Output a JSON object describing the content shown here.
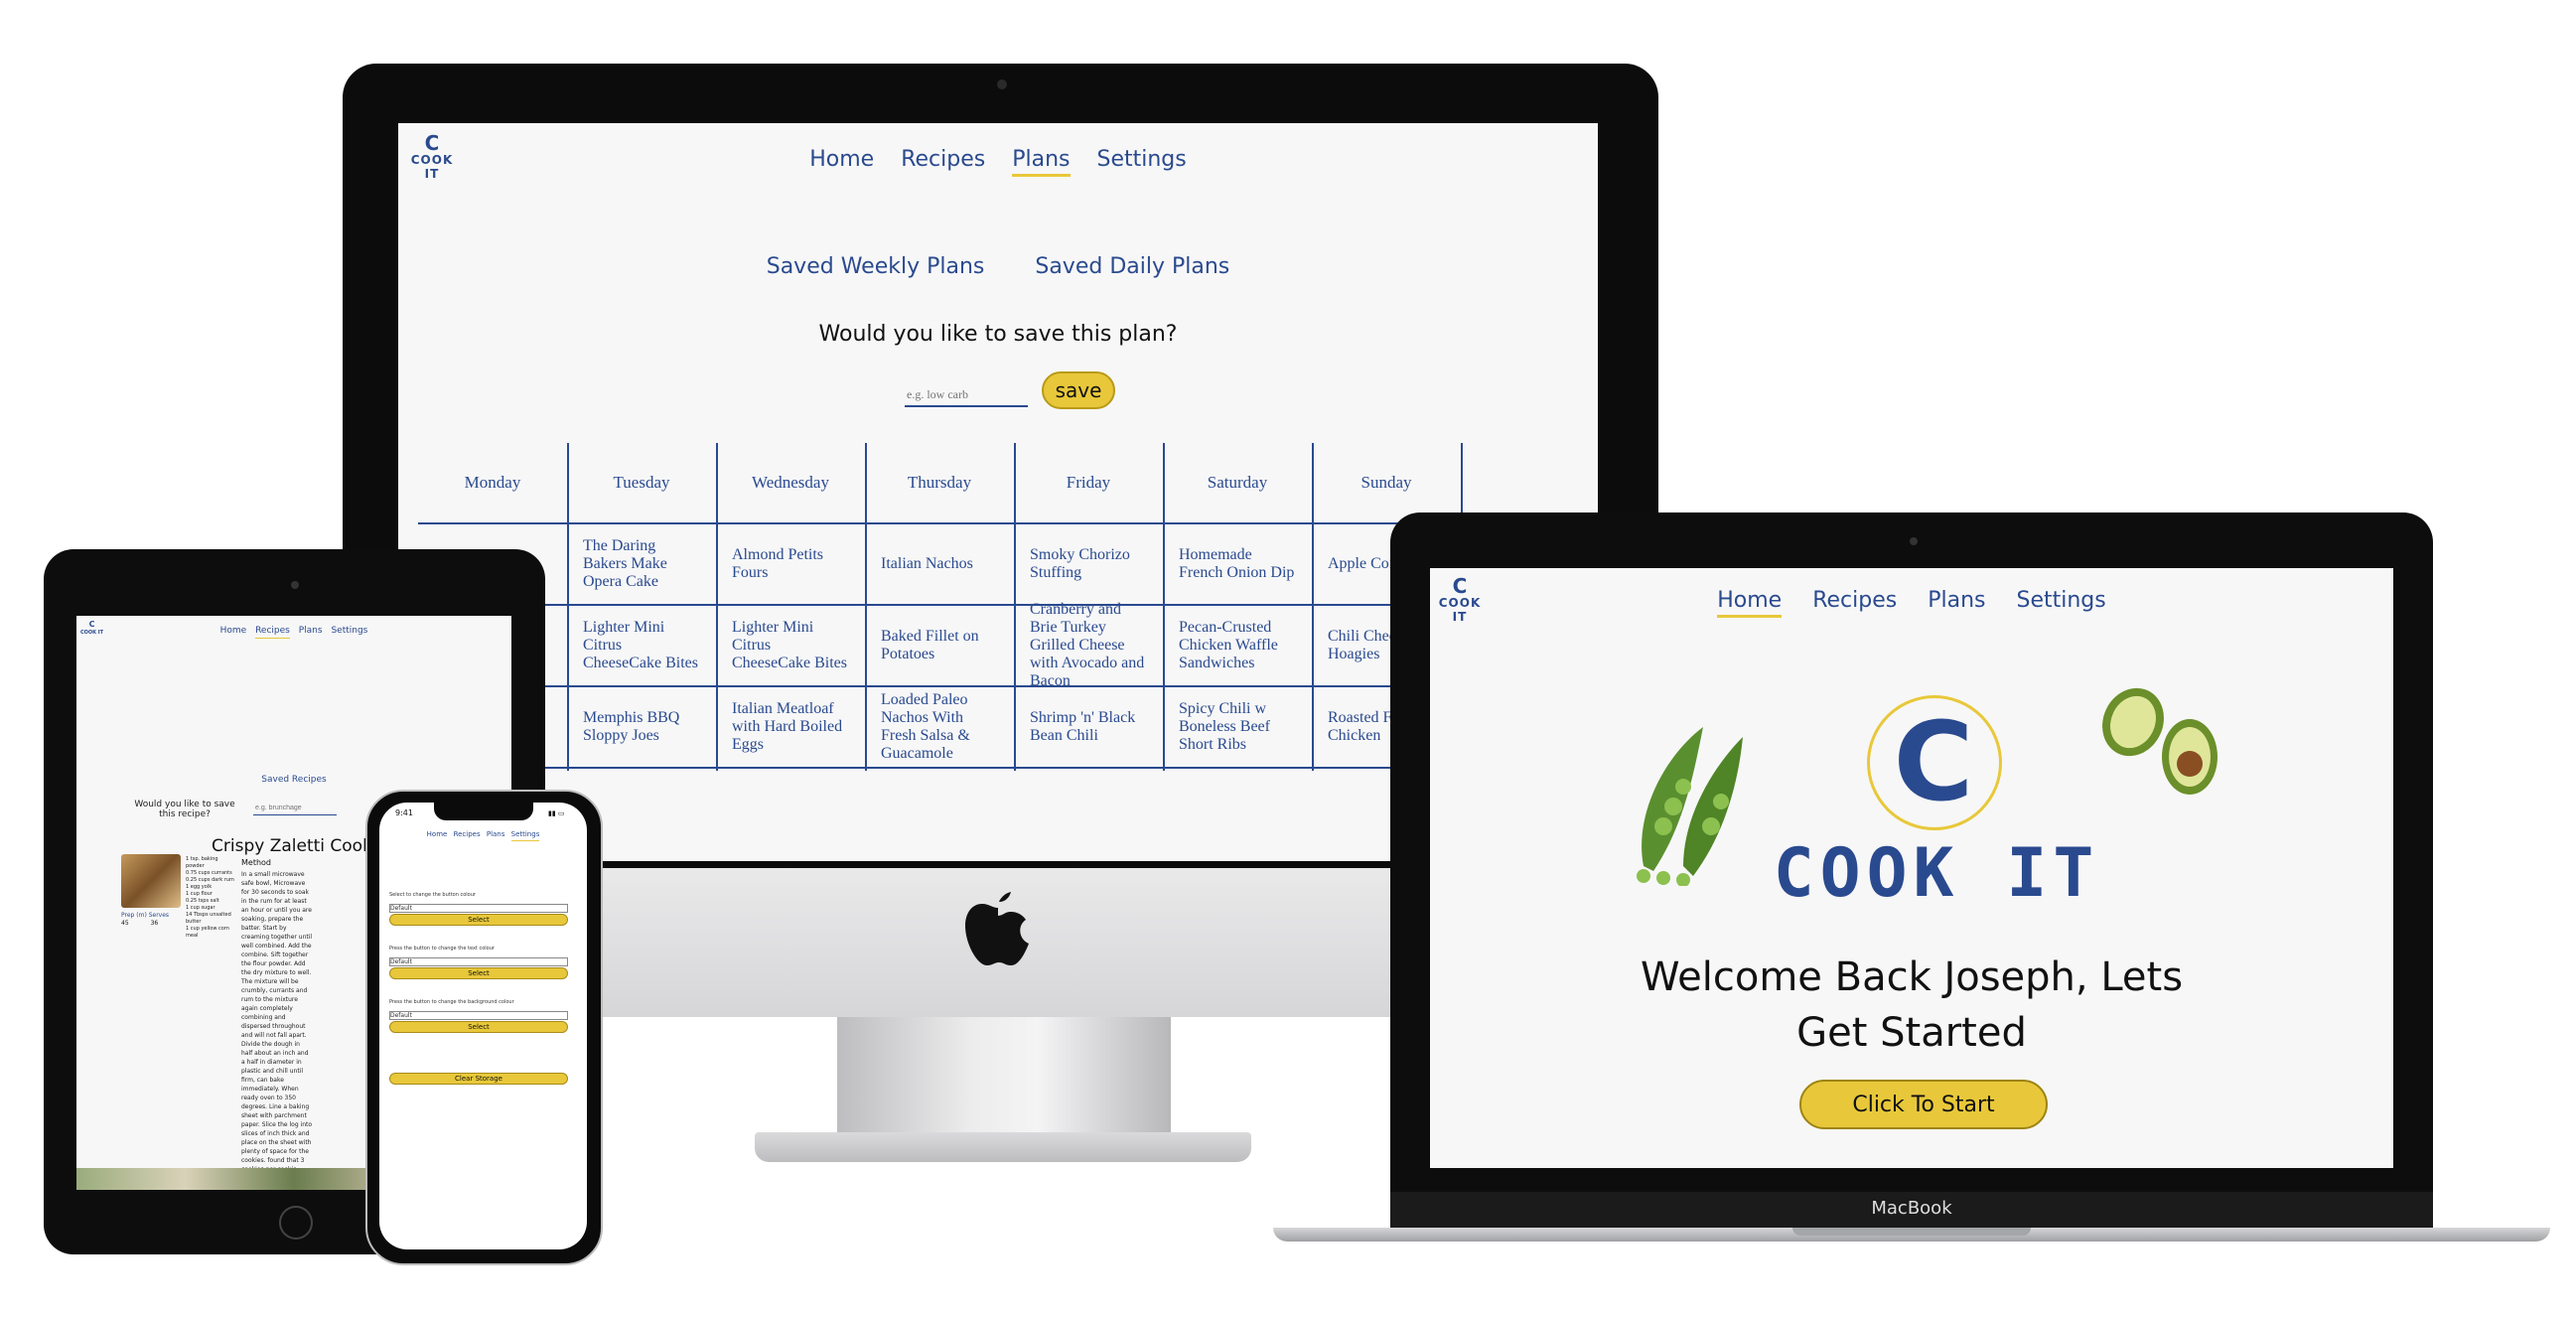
{
  "brand": {
    "logo_letter": "C",
    "logo_text": "COOK IT"
  },
  "nav": {
    "home": "Home",
    "recipes": "Recipes",
    "plans": "Plans",
    "settings": "Settings"
  },
  "imac": {
    "saved_weekly": "Saved Weekly Plans",
    "saved_daily": "Saved Daily Plans",
    "question": "Would you like to save this plan?",
    "input_placeholder": "e.g. low carb",
    "save_label": "save",
    "days": [
      {
        "name": "Monday",
        "meals": [
          "",
          "",
          ""
        ]
      },
      {
        "name": "Tuesday",
        "meals": [
          "The Daring Bakers Make Opera Cake",
          "Lighter Mini Citrus CheeseCake Bites",
          "Memphis BBQ Sloppy Joes"
        ]
      },
      {
        "name": "Wednesday",
        "meals": [
          "Almond Petits Fours",
          "Lighter Mini Citrus CheeseCake Bites",
          "Italian Meatloaf with Hard Boiled Eggs"
        ]
      },
      {
        "name": "Thursday",
        "meals": [
          "Italian Nachos",
          "Baked Fillet on Potatoes",
          "Loaded Paleo Nachos With Fresh Salsa & Guacamole"
        ]
      },
      {
        "name": "Friday",
        "meals": [
          "Smoky Chorizo Stuffing",
          "Cranberry and Brie Turkey Grilled Cheese with Avocado and Bacon",
          "Shrimp 'n' Black Bean Chili"
        ]
      },
      {
        "name": "Saturday",
        "meals": [
          "Homemade French Onion Dip",
          "Pecan-Crusted Chicken Waffle Sandwiches",
          "Spicy Chili w Boneless Beef Short Ribs"
        ]
      },
      {
        "name": "Sunday",
        "meals": [
          "Apple Coffe",
          "Chili Chees Hoagies",
          "Roasted Free Chicken"
        ]
      }
    ]
  },
  "ipad": {
    "saved_recipes": "Saved Recipes",
    "question": "Would you like to save this recipe?",
    "input_placeholder": "e.g. brunchage",
    "recipe_title": "Crispy Zaletti Cooki",
    "method_label": "Method",
    "prep_label": "Prep (m)",
    "serves_label": "Serves",
    "prep_value": "45",
    "serves_value": "36"
  },
  "iphone": {
    "time": "9:41",
    "button_colour_label": "Select to change the button colour",
    "text_colour_label": "Press the button to change the text colour",
    "bg_colour_label": "Press the button to change the background colour",
    "select_default": "Default",
    "select_label": "Select",
    "clear_storage": "Clear Storage"
  },
  "macbook": {
    "welcome_line1": "Welcome Back Joseph, Lets",
    "welcome_line2": "Get Started",
    "start_label": "Click To Start",
    "device_label": "MacBook"
  },
  "colors": {
    "accent": "#e8c83a",
    "brand": "#2a4a8f",
    "background": "#f7f7f7"
  }
}
